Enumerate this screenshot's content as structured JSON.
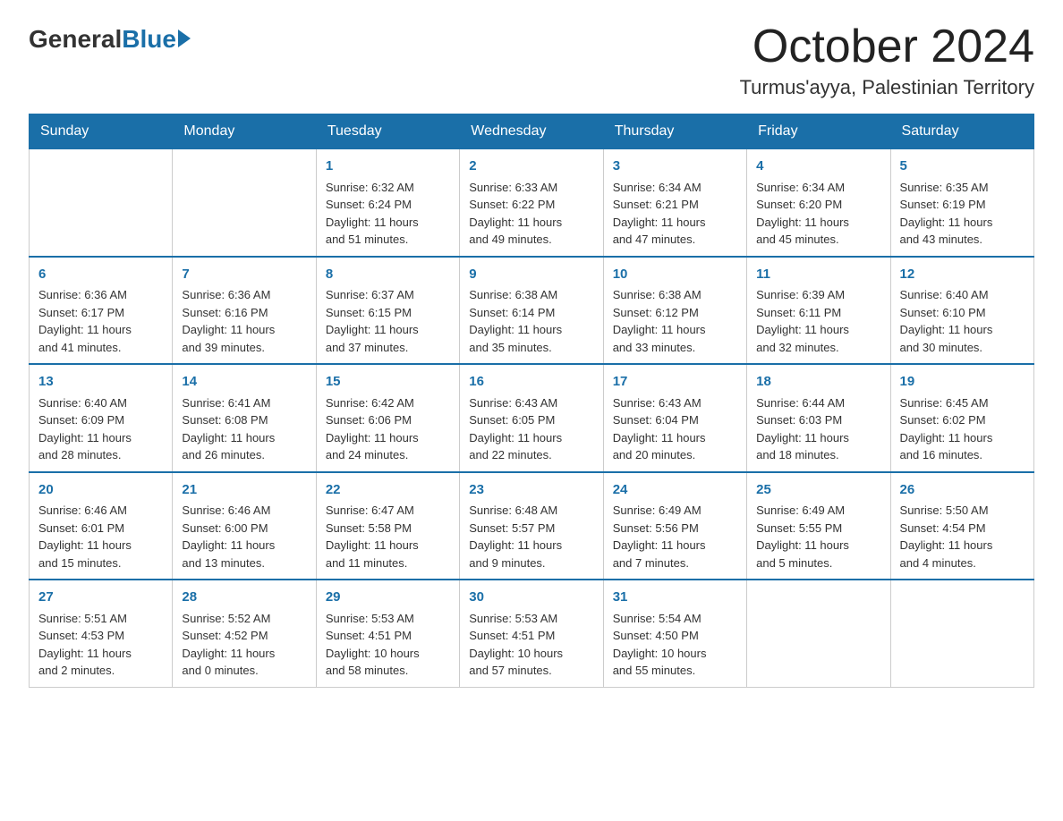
{
  "header": {
    "logo_general": "General",
    "logo_blue": "Blue",
    "month": "October 2024",
    "location": "Turmus'ayya, Palestinian Territory"
  },
  "days": [
    "Sunday",
    "Monday",
    "Tuesday",
    "Wednesday",
    "Thursday",
    "Friday",
    "Saturday"
  ],
  "weeks": [
    [
      {
        "day": "",
        "info": ""
      },
      {
        "day": "",
        "info": ""
      },
      {
        "day": "1",
        "info": "Sunrise: 6:32 AM\nSunset: 6:24 PM\nDaylight: 11 hours\nand 51 minutes."
      },
      {
        "day": "2",
        "info": "Sunrise: 6:33 AM\nSunset: 6:22 PM\nDaylight: 11 hours\nand 49 minutes."
      },
      {
        "day": "3",
        "info": "Sunrise: 6:34 AM\nSunset: 6:21 PM\nDaylight: 11 hours\nand 47 minutes."
      },
      {
        "day": "4",
        "info": "Sunrise: 6:34 AM\nSunset: 6:20 PM\nDaylight: 11 hours\nand 45 minutes."
      },
      {
        "day": "5",
        "info": "Sunrise: 6:35 AM\nSunset: 6:19 PM\nDaylight: 11 hours\nand 43 minutes."
      }
    ],
    [
      {
        "day": "6",
        "info": "Sunrise: 6:36 AM\nSunset: 6:17 PM\nDaylight: 11 hours\nand 41 minutes."
      },
      {
        "day": "7",
        "info": "Sunrise: 6:36 AM\nSunset: 6:16 PM\nDaylight: 11 hours\nand 39 minutes."
      },
      {
        "day": "8",
        "info": "Sunrise: 6:37 AM\nSunset: 6:15 PM\nDaylight: 11 hours\nand 37 minutes."
      },
      {
        "day": "9",
        "info": "Sunrise: 6:38 AM\nSunset: 6:14 PM\nDaylight: 11 hours\nand 35 minutes."
      },
      {
        "day": "10",
        "info": "Sunrise: 6:38 AM\nSunset: 6:12 PM\nDaylight: 11 hours\nand 33 minutes."
      },
      {
        "day": "11",
        "info": "Sunrise: 6:39 AM\nSunset: 6:11 PM\nDaylight: 11 hours\nand 32 minutes."
      },
      {
        "day": "12",
        "info": "Sunrise: 6:40 AM\nSunset: 6:10 PM\nDaylight: 11 hours\nand 30 minutes."
      }
    ],
    [
      {
        "day": "13",
        "info": "Sunrise: 6:40 AM\nSunset: 6:09 PM\nDaylight: 11 hours\nand 28 minutes."
      },
      {
        "day": "14",
        "info": "Sunrise: 6:41 AM\nSunset: 6:08 PM\nDaylight: 11 hours\nand 26 minutes."
      },
      {
        "day": "15",
        "info": "Sunrise: 6:42 AM\nSunset: 6:06 PM\nDaylight: 11 hours\nand 24 minutes."
      },
      {
        "day": "16",
        "info": "Sunrise: 6:43 AM\nSunset: 6:05 PM\nDaylight: 11 hours\nand 22 minutes."
      },
      {
        "day": "17",
        "info": "Sunrise: 6:43 AM\nSunset: 6:04 PM\nDaylight: 11 hours\nand 20 minutes."
      },
      {
        "day": "18",
        "info": "Sunrise: 6:44 AM\nSunset: 6:03 PM\nDaylight: 11 hours\nand 18 minutes."
      },
      {
        "day": "19",
        "info": "Sunrise: 6:45 AM\nSunset: 6:02 PM\nDaylight: 11 hours\nand 16 minutes."
      }
    ],
    [
      {
        "day": "20",
        "info": "Sunrise: 6:46 AM\nSunset: 6:01 PM\nDaylight: 11 hours\nand 15 minutes."
      },
      {
        "day": "21",
        "info": "Sunrise: 6:46 AM\nSunset: 6:00 PM\nDaylight: 11 hours\nand 13 minutes."
      },
      {
        "day": "22",
        "info": "Sunrise: 6:47 AM\nSunset: 5:58 PM\nDaylight: 11 hours\nand 11 minutes."
      },
      {
        "day": "23",
        "info": "Sunrise: 6:48 AM\nSunset: 5:57 PM\nDaylight: 11 hours\nand 9 minutes."
      },
      {
        "day": "24",
        "info": "Sunrise: 6:49 AM\nSunset: 5:56 PM\nDaylight: 11 hours\nand 7 minutes."
      },
      {
        "day": "25",
        "info": "Sunrise: 6:49 AM\nSunset: 5:55 PM\nDaylight: 11 hours\nand 5 minutes."
      },
      {
        "day": "26",
        "info": "Sunrise: 5:50 AM\nSunset: 4:54 PM\nDaylight: 11 hours\nand 4 minutes."
      }
    ],
    [
      {
        "day": "27",
        "info": "Sunrise: 5:51 AM\nSunset: 4:53 PM\nDaylight: 11 hours\nand 2 minutes."
      },
      {
        "day": "28",
        "info": "Sunrise: 5:52 AM\nSunset: 4:52 PM\nDaylight: 11 hours\nand 0 minutes."
      },
      {
        "day": "29",
        "info": "Sunrise: 5:53 AM\nSunset: 4:51 PM\nDaylight: 10 hours\nand 58 minutes."
      },
      {
        "day": "30",
        "info": "Sunrise: 5:53 AM\nSunset: 4:51 PM\nDaylight: 10 hours\nand 57 minutes."
      },
      {
        "day": "31",
        "info": "Sunrise: 5:54 AM\nSunset: 4:50 PM\nDaylight: 10 hours\nand 55 minutes."
      },
      {
        "day": "",
        "info": ""
      },
      {
        "day": "",
        "info": ""
      }
    ]
  ]
}
